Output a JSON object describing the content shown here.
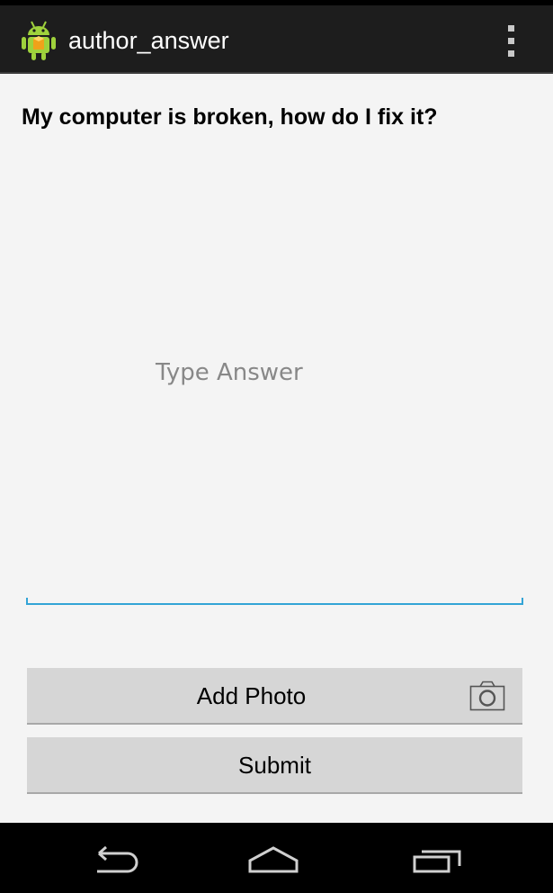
{
  "status_bar": {},
  "action_bar": {
    "title": "author_answer",
    "app_icon": "android-robot-icon",
    "overflow_icon": "overflow-menu-icon"
  },
  "main": {
    "question": "My computer is broken, how do I fix it?",
    "answer": {
      "value": "",
      "placeholder": "Type Answer"
    },
    "add_photo_button": {
      "label": "Add Photo",
      "icon": "camera-icon"
    },
    "submit_button": {
      "label": "Submit"
    }
  },
  "navigation_bar": {
    "back_icon": "back-icon",
    "home_icon": "home-icon",
    "recent_icon": "recent-apps-icon"
  },
  "colors": {
    "action_bar_bg": "#1d1d1d",
    "accent": "#33a4d6",
    "content_bg": "#f4f4f4",
    "button_bg": "#d6d6d6"
  }
}
